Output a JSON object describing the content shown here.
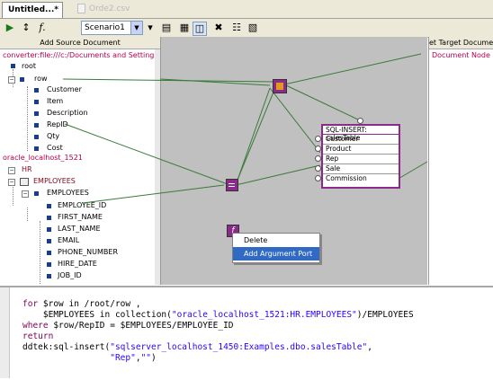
{
  "tabs": [
    {
      "label": "Untitled...*"
    },
    {
      "label": "Orde2.csv"
    }
  ],
  "toolbar": {
    "scenario": "Scenario1",
    "icons": [
      "run-icon",
      "zoom-fit-icon",
      "function-icon",
      "dropdown-icon",
      "map-view-icon",
      "image-icon",
      "split-view-icon",
      "collapse-icon",
      "grid-icon",
      "table-icon"
    ]
  },
  "left_panel": {
    "header": "Add Source Document",
    "source1": "converter:file:///c:/Documents and Settings/jpar",
    "root": "root",
    "row": "row",
    "row_fields": [
      "Customer",
      "Item",
      "Description",
      "RepID",
      "Qty",
      "Cost"
    ],
    "source2": "oracle_localhost_1521",
    "schema": "HR",
    "table": "EMPLOYEES",
    "table_row": "EMPLOYEES",
    "emp_fields": [
      "EMPLOYEE_ID",
      "FIRST_NAME",
      "LAST_NAME",
      "EMAIL",
      "PHONE_NUMBER",
      "HIRE_DATE",
      "JOB_ID"
    ]
  },
  "canvas": {
    "sql_table": {
      "title": "SQL-INSERT: salesTable",
      "fields": [
        "Customer",
        "Product",
        "Rep",
        "Sale",
        "Commission"
      ]
    },
    "context_menu": {
      "items": [
        "Delete",
        "Add Argument Port"
      ],
      "selected": "Add Argument Port"
    }
  },
  "right_panel": {
    "header": "et Target Docume",
    "node": "Document Node"
  },
  "code": {
    "lines": [
      [
        "for $row in /root/row ,"
      ],
      [
        "    $EMPLOYEES in collection(\"oracle_localhost_1521:HR.EMPLOYEES\")/EMPLOYEES"
      ],
      [
        "where $row/RepID = $EMPLOYEES/EMPLOYEE_ID"
      ],
      [
        "return"
      ],
      [
        "ddtek:sql-insert(\"sqlserver_localhost_1450:Examples.dbo.salesTable\","
      ],
      [
        "                 \"Rep\",\"\")"
      ]
    ],
    "l1_kw": "for",
    "l1_rest": " $row in /root/row ,",
    "l2_pre": "    $EMPLOYEES in collection(",
    "l2_str": "\"oracle_localhost_1521:HR.EMPLOYEES\"",
    "l2_post": ")/EMPLOYEES",
    "l3_kw": "where",
    "l3_rest": " $row/RepID = $EMPLOYEES/EMPLOYEE_ID",
    "l4_kw": "return",
    "l5_pre": "ddtek:sql-insert(",
    "l5_str": "\"sqlserver_localhost_1450:Examples.dbo.salesTable\"",
    "l5_post": ",",
    "l6_pre": "                 ",
    "l6_str": "\"Rep\"",
    "l6_mid": ",",
    "l6_str2": "\"\"",
    "l6_post": ")"
  },
  "colors": {
    "accent": "#316ac5",
    "node_purple": "#8b2a8b",
    "link_green": "#3a7a3a",
    "source_red": "#b3004d"
  }
}
